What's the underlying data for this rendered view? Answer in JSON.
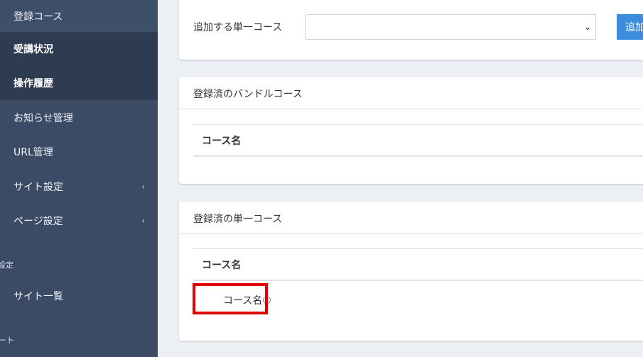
{
  "sidebar": {
    "items": [
      {
        "label": "登録コース"
      },
      {
        "label": "受講状況"
      },
      {
        "label": "操作履歴"
      },
      {
        "label": "お知らせ管理"
      },
      {
        "label": "URL管理"
      },
      {
        "label": "サイト設定",
        "chevron": "‹"
      },
      {
        "label": "ページ設定",
        "chevron": "‹"
      }
    ],
    "section1": "設定",
    "site_list": "サイト一覧",
    "section2": "ート"
  },
  "add_course": {
    "label": "追加する単一コース",
    "select_value": "",
    "caret": "⌄",
    "button": "追加"
  },
  "bundle_card": {
    "title": "登録済のバンドルコース",
    "column_header": "コース名"
  },
  "single_card": {
    "title": "登録済の単一コース",
    "column_header": "コース名",
    "rows": [
      {
        "course_name": "コース名①"
      }
    ]
  },
  "colors": {
    "sidebar": "#3b4b66",
    "sidebar_active": "#2f3b51",
    "accent": "#3c8dde",
    "highlight": "#e00000"
  }
}
